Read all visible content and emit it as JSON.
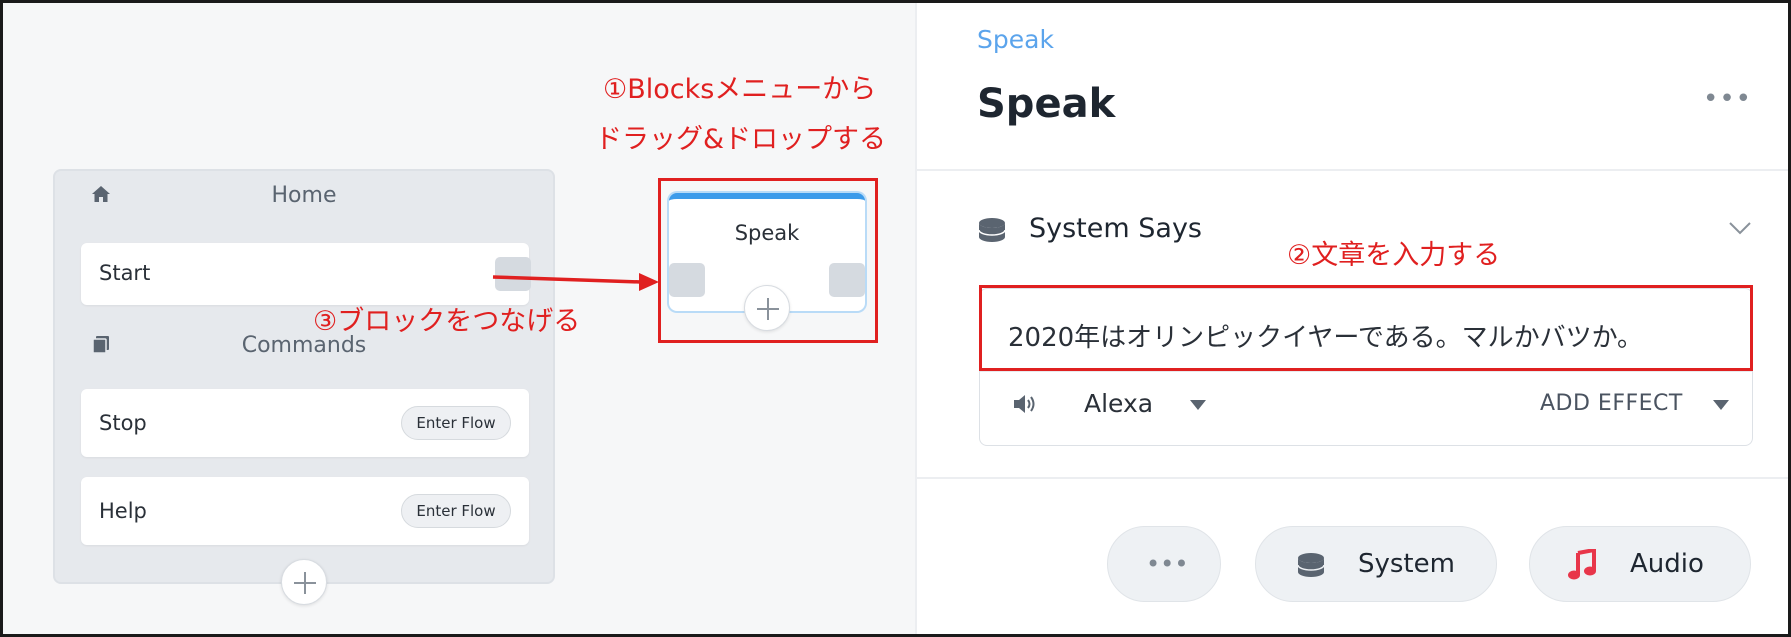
{
  "annotations": {
    "step1_line1": "①Blocksメニューから",
    "step1_line2": "ドラッグ&ドロップする",
    "step2": "②文章を入力する",
    "step3": "③ブロックをつなげる",
    "highlight_color": "#e02020"
  },
  "canvas": {
    "home_block": {
      "home_icon": "home-icon",
      "home_title": "Home",
      "start_label": "Start",
      "commands_icon": "book-stack-icon",
      "commands_title": "Commands",
      "rows": [
        {
          "label": "Stop",
          "action": "Enter Flow"
        },
        {
          "label": "Help",
          "action": "Enter Flow"
        }
      ]
    },
    "speak_block": {
      "title": "Speak",
      "accent": "#3c9bea"
    }
  },
  "panel": {
    "breadcrumb": "Speak",
    "title": "Speak",
    "section_label": "System Says",
    "section_icon": "database-icon",
    "message": "2020年はオリンピックイヤーである。マルかバツか。",
    "voice": "Alexa",
    "add_effect": "ADD EFFECT",
    "buttons": {
      "more": "more-icon",
      "system": "System",
      "audio": "Audio"
    },
    "accent": "#5ba4ec",
    "audio_icon_color": "#e8364a"
  }
}
